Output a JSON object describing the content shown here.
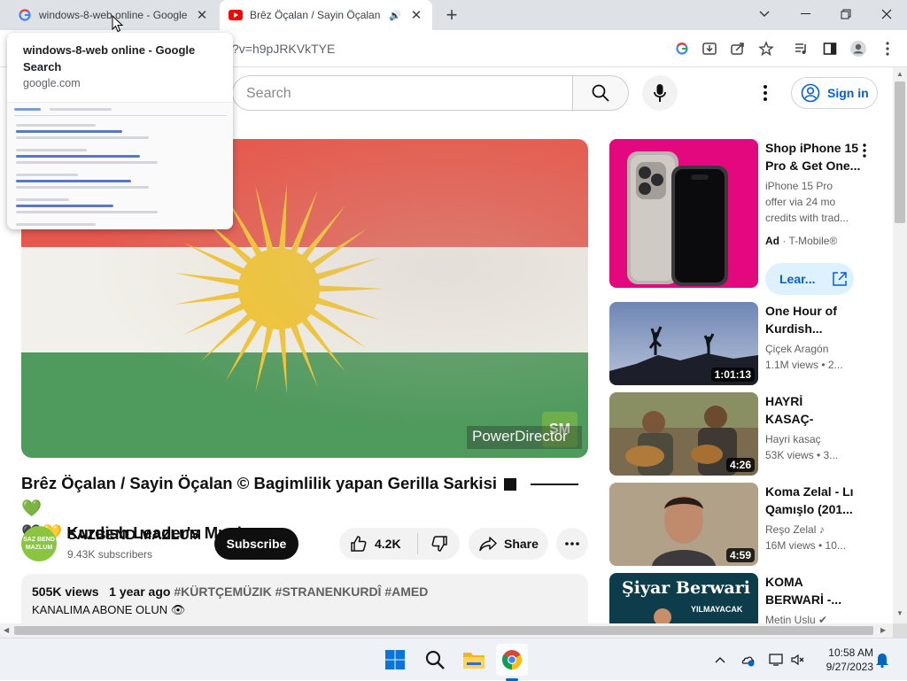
{
  "browser": {
    "tabs": [
      {
        "title": "windows-8-web online - Google",
        "favicon": "google-icon",
        "active": false
      },
      {
        "title": "Brêz Öçalan / Sayin Öçalan",
        "favicon": "youtube-icon",
        "active": true,
        "audio": "speaker-icon"
      }
    ],
    "url_fragment": "?v=h9pJRKVkTYE",
    "hover_card": {
      "title": "windows-8-web online - Google Search",
      "domain": "google.com"
    }
  },
  "youtube": {
    "search_placeholder": "Search",
    "signin_label": "Sign in",
    "video": {
      "watermark": "PowerDirector",
      "watermark_logo": "SM",
      "title_part1": "Brêz Öçalan / Sayin Öçalan © Bagimlilik yapan Gerilla Sarkisi",
      "title_emoji_end": "💚",
      "title_emoji_start": "🖤💛",
      "title_part2": "Kurdish Leader's Music",
      "channel_name": "SAZBEND MAZLUM",
      "channel_avatar_text": "SAZ BEND MAZLUM",
      "subscribers": "9.43K subscribers",
      "subscribe_label": "Subscribe",
      "likes": "4.2K",
      "share_label": "Share",
      "views": "505K views",
      "age": "1 year ago",
      "hashtags": "#KÜRTÇEMÜZIK #STRANENKURDÎ #AMED",
      "description_line": "KANALIMA ABONE OLUN 👁"
    },
    "sidebar": [
      {
        "type": "ad",
        "title": "Shop iPhone 15 Pro & Get One...",
        "desc": "iPhone 15 Pro offer via 24 mo credits with trad...",
        "ad_label": "Ad",
        "advertiser": "T-Mobile®",
        "cta": "Lear..."
      },
      {
        "title": "One Hour of Kurdish...",
        "channel": "Çiçek Aragón",
        "views": "1.1M views • 2...",
        "duration": "1:01:13"
      },
      {
        "title": "HAYRİ KASAÇ-BEHSA EVİNE...",
        "channel": "Hayri kasaç",
        "views": "53K views • 3...",
        "duration": "4:26"
      },
      {
        "title": "Koma Zelal - Lı Qamışlo (201...",
        "channel": "Reşo Zelal ♪",
        "views": "16M views • 10...",
        "duration": "4:59"
      },
      {
        "title": "KOMA BERWARİ -...",
        "channel": "Metin Uslu ✔",
        "thumb_text": "Şiyar Berwari",
        "thumb_sub": "YILMAYACAK"
      }
    ]
  },
  "taskbar": {
    "time": "10:58 AM",
    "date": "9/27/2023"
  },
  "colors": {
    "youtube_red": "#ff0000",
    "link_blue": "#065fd4",
    "ad_pink": "#e4087f",
    "flag_red": "#e6584c",
    "flag_green": "#4f9a5d",
    "sun_yellow": "#f4c52c"
  }
}
